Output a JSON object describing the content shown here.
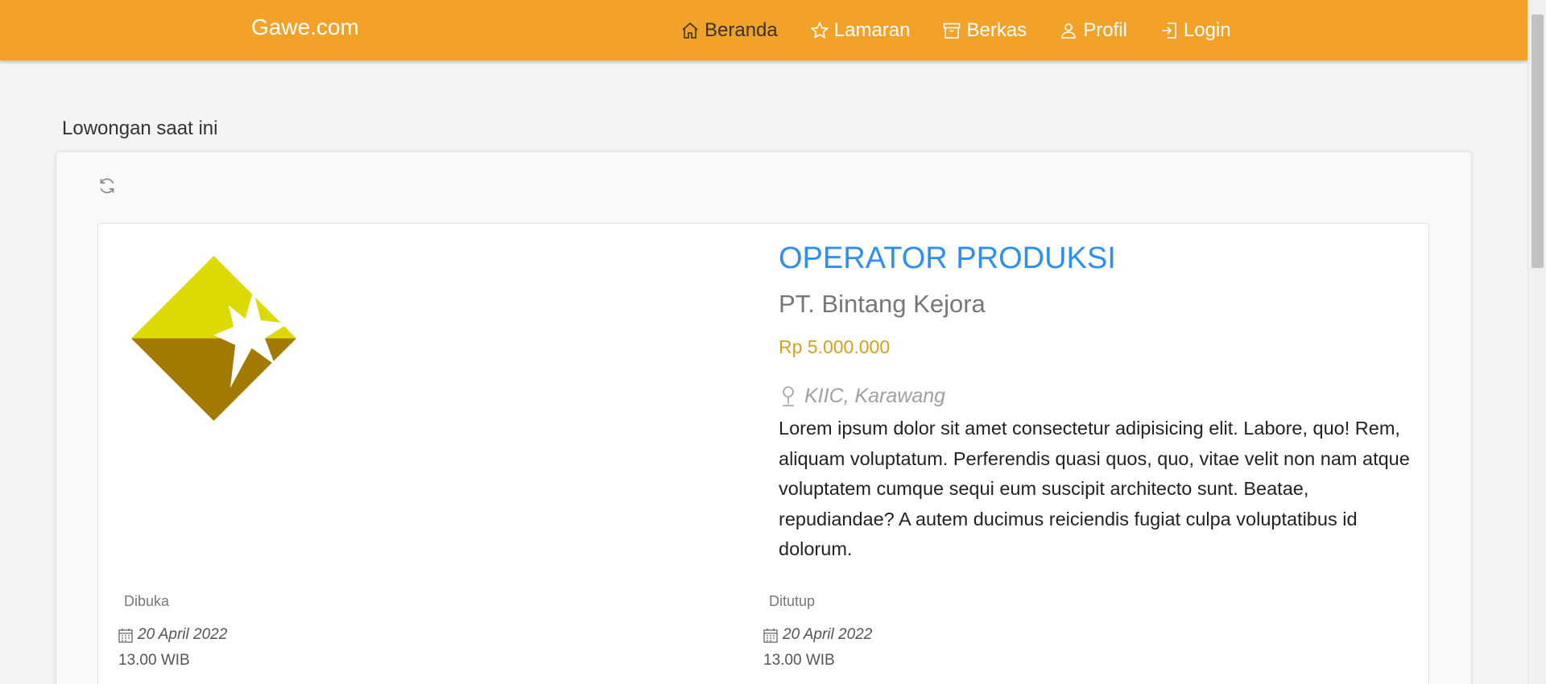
{
  "navbar": {
    "brand": "Gawe.com",
    "color": "#f2a229",
    "items": [
      {
        "label": "Beranda",
        "icon": "home-icon",
        "active": true
      },
      {
        "label": "Lamaran",
        "icon": "star-icon",
        "active": false
      },
      {
        "label": "Berkas",
        "icon": "archive-icon",
        "active": false
      },
      {
        "label": "Profil",
        "icon": "user-icon",
        "active": false
      },
      {
        "label": "Login",
        "icon": "login-icon",
        "active": false
      }
    ]
  },
  "main": {
    "section_title": "Lowongan saat ini",
    "refresh_icon": "refresh-icon"
  },
  "job": {
    "title": "OPERATOR PRODUKSI",
    "company": "PT. Bintang Kejora",
    "salary": "Rp 5.000.000",
    "location": "KIIC, Karawang",
    "description": "Lorem ipsum dolor sit amet consectetur adipisicing elit. Labore, quo! Rem, aliquam voluptatum. Perferendis quasi quos, quo, vitae velit non nam atque voluptatem cumque sequi eum suscipit architecto sunt. Beatae, repudiandae? A autem ducimus reiciendis fugiat culpa voluptatibus id dolorum.",
    "opened": {
      "label": "Dibuka",
      "date": "20 April 2022",
      "time": "13.00 WIB"
    },
    "closed": {
      "label": "Ditutup",
      "date": "20 April 2022",
      "time": "13.00 WIB"
    },
    "title_color": "#2e8ff0",
    "salary_color": "#d6a11b"
  }
}
